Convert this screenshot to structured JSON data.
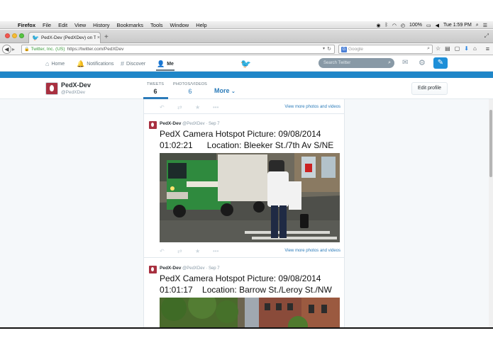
{
  "menubar": {
    "app": "Firefox",
    "items": [
      "File",
      "Edit",
      "View",
      "History",
      "Bookmarks",
      "Tools",
      "Window",
      "Help"
    ],
    "battery": "100%",
    "clock": "Tue 1:59 PM"
  },
  "tab": {
    "title": "PedX-Dev (PedXDev) on T...",
    "close": "×",
    "new_tab": "+"
  },
  "navbar": {
    "identity": "Twitter, Inc. (US)",
    "url": "https://twitter.com/PedXDev",
    "search_placeholder": "Google"
  },
  "twitter_nav": {
    "home": "Home",
    "notifications": "Notifications",
    "discover": "Discover",
    "me": "Me",
    "search_placeholder": "Search Twitter"
  },
  "profile": {
    "name": "PedX-Dev",
    "handle": "@PedXDev",
    "tweets_label": "TWEETS",
    "tweets_count": "6",
    "photos_label": "PHOTOS/VIDEOS",
    "photos_count": "6",
    "more": "More",
    "edit_profile": "Edit profile"
  },
  "timeline": {
    "view_more": "View more photos and videos",
    "tweets": [
      {
        "name": "PedX-Dev",
        "meta": "@PedXDev · Sep 7",
        "text": "PedX Camera Hotspot Picture: 09/08/2014\n01:02:21      Location: Bleeker St./7th Av S/NE"
      },
      {
        "name": "PedX-Dev",
        "meta": "@PedXDev · Sep 7",
        "text": "PedX Camera Hotspot Picture: 09/08/2014\n01:01:17    Location: Barrow St./Leroy St./NW"
      }
    ]
  },
  "colors": {
    "twitter_blue": "#55acee",
    "banner_blue": "#1f86c8",
    "link_blue": "#2b7bb9",
    "avatar_red": "#a83040"
  }
}
